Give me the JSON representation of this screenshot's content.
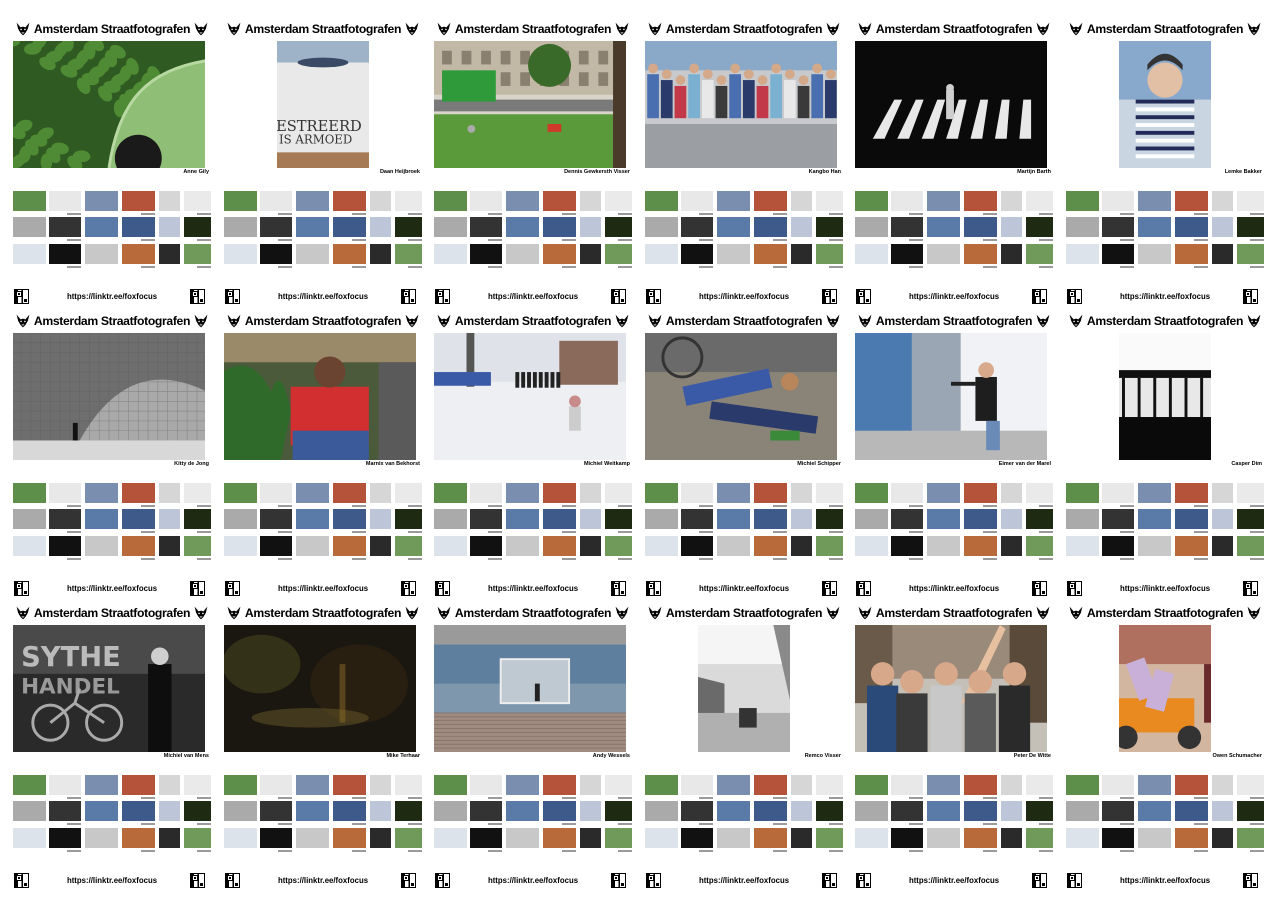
{
  "header_title": "Amsterdam Straatfotografen",
  "footer_link": "https://linktr.ee/foxfocus",
  "icons": {
    "logo": "fox-head-icon",
    "qr": "qr-code-icon"
  },
  "cards": [
    {
      "photographer": "Anne Gily",
      "photo_desc": "ivy-car",
      "orientation": "landscape"
    },
    {
      "photographer": "Daan Heijbroek",
      "photo_desc": "graffiti-wall",
      "orientation": "portrait"
    },
    {
      "photographer": "Dennis Gewkersth Visser",
      "photo_desc": "green-truck-geese",
      "orientation": "landscape"
    },
    {
      "photographer": "Kangbo Han",
      "photo_desc": "crowd-bench",
      "orientation": "landscape"
    },
    {
      "photographer": "Martijn Barth",
      "photo_desc": "night-crosswalk",
      "orientation": "landscape"
    },
    {
      "photographer": "Lemke Bakker",
      "photo_desc": "woman-striped-shirt",
      "orientation": "portrait"
    },
    {
      "photographer": "Kitty de Jong",
      "photo_desc": "tiled-wall-shadow",
      "orientation": "landscape"
    },
    {
      "photographer": "Marnix van Bekhorst",
      "photo_desc": "man-red-shirt",
      "orientation": "landscape"
    },
    {
      "photographer": "Michiel Weitkamp",
      "photo_desc": "snow-police",
      "orientation": "landscape"
    },
    {
      "photographer": "Michiel Schipper",
      "photo_desc": "men-on-street",
      "orientation": "landscape"
    },
    {
      "photographer": "Eimer van der Marel",
      "photo_desc": "boy-with-gun",
      "orientation": "landscape"
    },
    {
      "photographer": "Casper Dim",
      "photo_desc": "station-silhouette",
      "orientation": "portrait"
    },
    {
      "photographer": "Michiel van Mens",
      "photo_desc": "woman-bicycle-bw",
      "orientation": "landscape"
    },
    {
      "photographer": "Mike Terhaar",
      "photo_desc": "night-blur",
      "orientation": "landscape"
    },
    {
      "photographer": "Andy Wessels",
      "photo_desc": "underpass-cyclist",
      "orientation": "landscape"
    },
    {
      "photographer": "Remco Visser",
      "photo_desc": "street-bw",
      "orientation": "portrait"
    },
    {
      "photographer": "Peter De Witte",
      "photo_desc": "tourists-pointing",
      "orientation": "landscape"
    },
    {
      "photographer": "Owen Schumacher",
      "photo_desc": "cargo-bike-mannequins",
      "orientation": "portrait"
    }
  ],
  "grid_colors": [
    "#5d8f4a",
    "#e8e8e8",
    "#7a8fb0",
    "#b5523a",
    "#d6d6d6",
    "#eaeaea",
    "#aaaaaa",
    "#333333",
    "#5a7aa8",
    "#3d5a8a",
    "#bcc6d8",
    "#1e2a12",
    "#dde3ea",
    "#111111",
    "#c8c8c8",
    "#b86a3a",
    "#2a2a2a",
    "#6f9a5a"
  ]
}
